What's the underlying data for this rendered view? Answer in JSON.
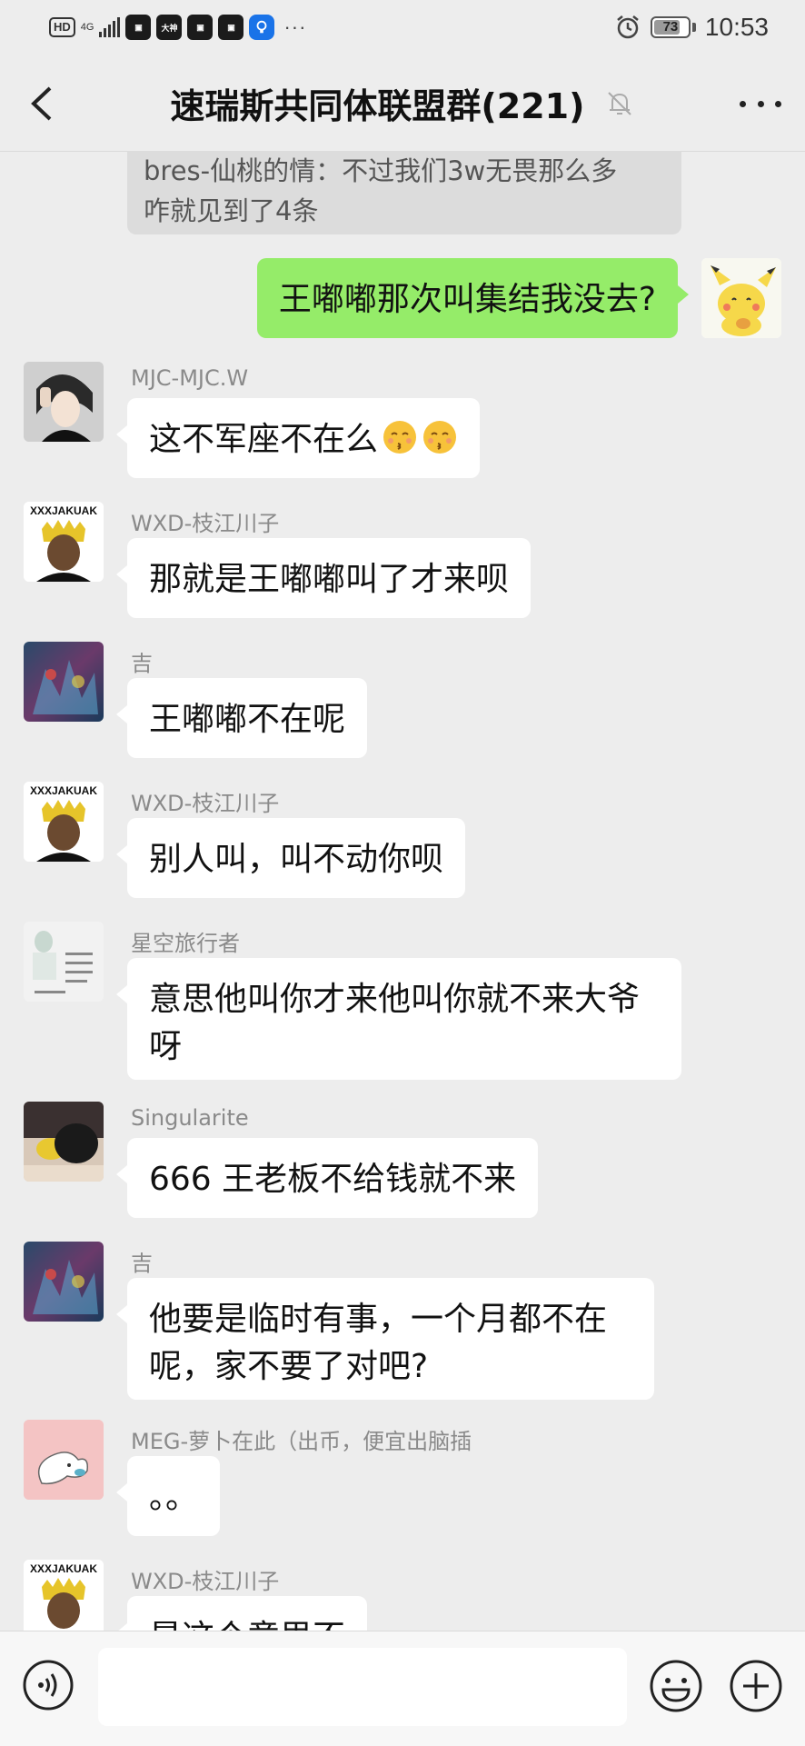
{
  "status_bar": {
    "hd": "HD",
    "network": "4G",
    "app_icons": [
      "app-icon-1",
      "大神",
      "app-icon-3",
      "app-icon-4",
      "bulb-app-icon"
    ],
    "more": "···",
    "battery": "73",
    "time": "10:53"
  },
  "header": {
    "title": "速瑞斯共同体联盟群(221)",
    "back_icon": "chevron-left-icon",
    "mute_icon": "bell-muted-icon",
    "menu_icon": "more-dots-icon"
  },
  "quoted": {
    "line1": "bres-仙桃的情：不过我们3w无畏那么多",
    "line2": "咋就见到了4条"
  },
  "messages": [
    {
      "sender": "",
      "text": "王嘟嘟那次叫集结我没去?",
      "mine": true
    },
    {
      "sender": "MJC-MJC.W",
      "text": "这不军座不在么"
    },
    {
      "sender": "WXD-枝江川子",
      "text": "那就是王嘟嘟叫了才来呗"
    },
    {
      "sender": "吉",
      "text": "王嘟嘟不在呢"
    },
    {
      "sender": "WXD-枝江川子",
      "text": "别人叫，叫不动你呗"
    },
    {
      "sender": "星空旅行者",
      "line1": "意思他叫你才来他叫你就不来大爷",
      "line2": "呀"
    },
    {
      "sender": "Singularite",
      "text": "666 王老板不给钱就不来"
    },
    {
      "sender": "吉",
      "line1": "他要是临时有事，一个月都不在",
      "line2": "呢，家不要了对吧?"
    },
    {
      "sender": "MEG-萝卜在此（出币，便宜出脑插",
      "text": "。。"
    },
    {
      "sender": "WXD-枝江川子",
      "text": "是这个意思不"
    }
  ],
  "bottom_bar": {
    "voice_icon": "voice-icon",
    "input_value": "",
    "emoji_icon": "smiley-icon",
    "plus_icon": "plus-circle-icon"
  },
  "colors": {
    "background": "#ededed",
    "my_bubble": "#95ec69",
    "other_bubble": "#ffffff"
  }
}
